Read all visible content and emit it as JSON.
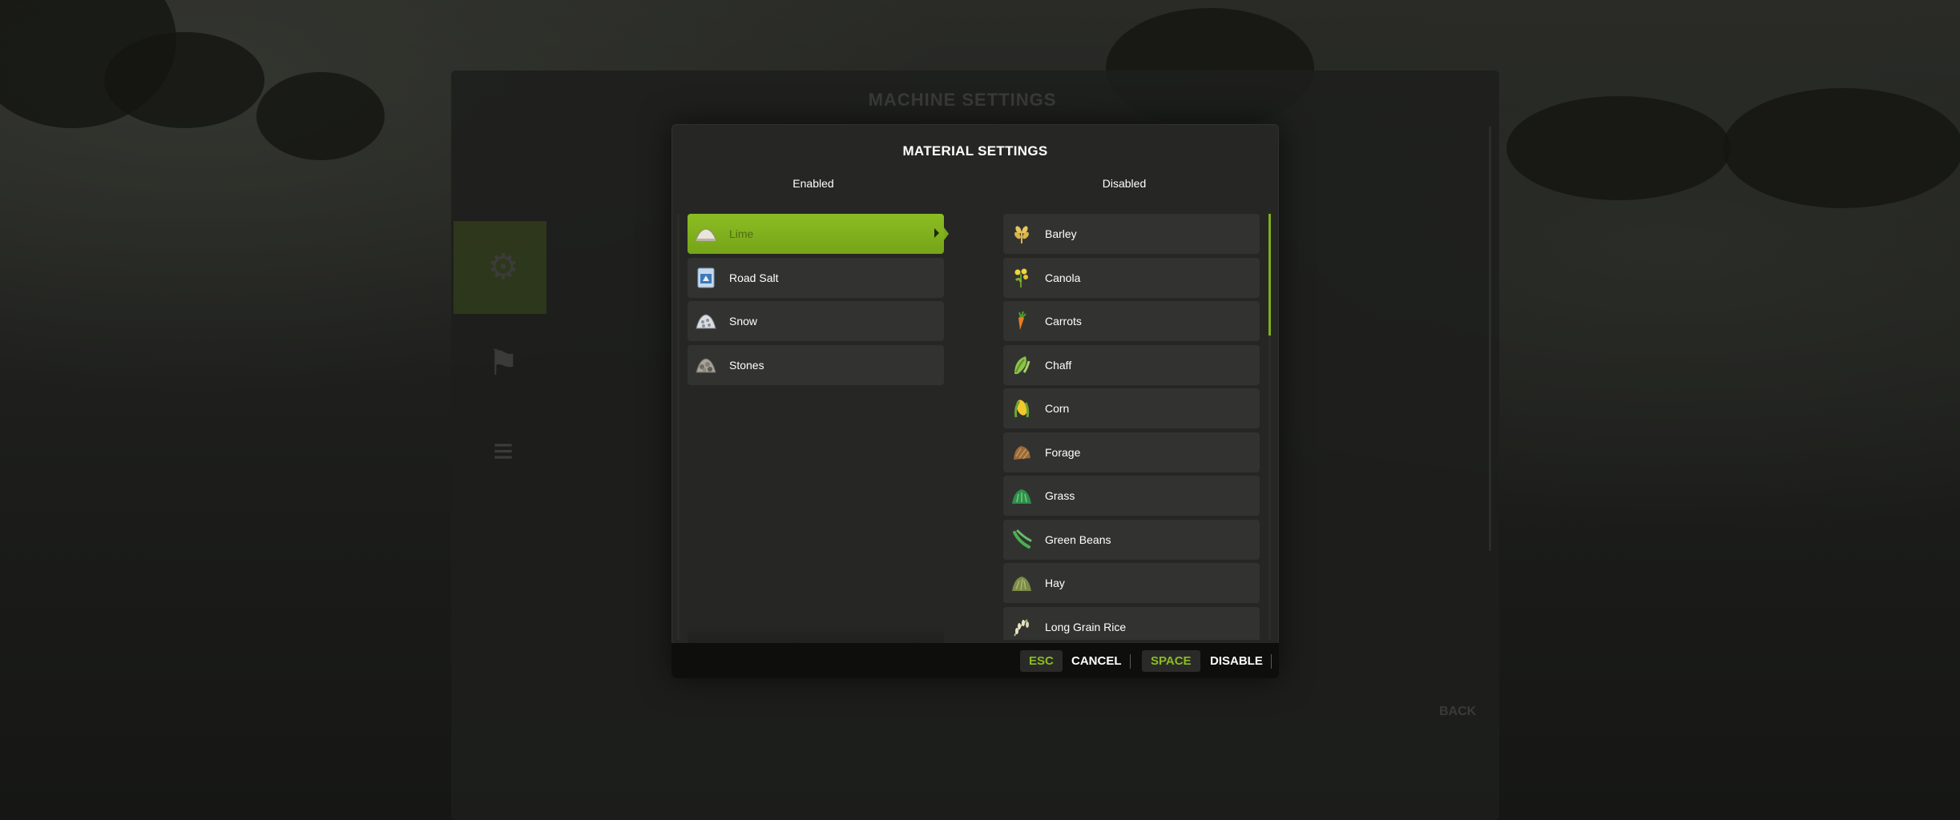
{
  "background": {
    "window_title": "MACHINE SETTINGS",
    "back_label": "BACK"
  },
  "dialog": {
    "title": "MATERIAL SETTINGS",
    "enabled_header": "Enabled",
    "disabled_header": "Disabled",
    "enabled_items": [
      {
        "label": "Lime",
        "icon": "lime-icon",
        "selected": true
      },
      {
        "label": "Road Salt",
        "icon": "road-salt-icon"
      },
      {
        "label": "Snow",
        "icon": "snow-icon"
      },
      {
        "label": "Stones",
        "icon": "stones-icon"
      }
    ],
    "disabled_items": [
      {
        "label": "Barley",
        "icon": "barley-icon"
      },
      {
        "label": "Canola",
        "icon": "canola-icon"
      },
      {
        "label": "Carrots",
        "icon": "carrots-icon"
      },
      {
        "label": "Chaff",
        "icon": "chaff-icon"
      },
      {
        "label": "Corn",
        "icon": "corn-icon"
      },
      {
        "label": "Forage",
        "icon": "forage-icon"
      },
      {
        "label": "Grass",
        "icon": "grass-icon"
      },
      {
        "label": "Green Beans",
        "icon": "green-beans-icon"
      },
      {
        "label": "Hay",
        "icon": "hay-icon"
      },
      {
        "label": "Long Grain Rice",
        "icon": "long-grain-rice-icon"
      }
    ]
  },
  "footer": {
    "cancel_key": "ESC",
    "cancel_label": "CANCEL",
    "disable_key": "SPACE",
    "disable_label": "DISABLE"
  },
  "colors": {
    "accent": "#7fae1d",
    "dialog_bg": "#262725",
    "item_bg": "#323331",
    "footer_bg": "#0e0e0d"
  }
}
